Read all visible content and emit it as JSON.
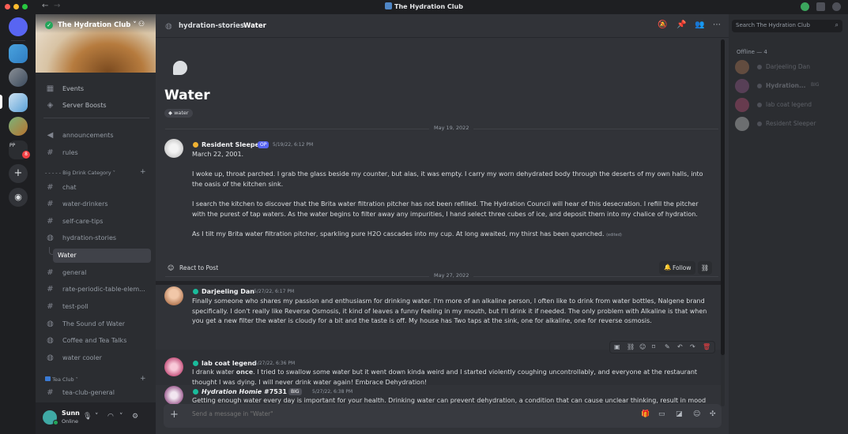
{
  "window": {
    "title": "The Hydration Club"
  },
  "server": {
    "name": "The Hydration Club"
  },
  "sidebar": {
    "top_items": [
      {
        "label": "Events",
        "icon": "calendar-icon"
      },
      {
        "label": "Server Boosts",
        "icon": "boost-icon"
      }
    ],
    "channels_before": [
      {
        "label": "announcements",
        "icon": "megaphone-icon"
      },
      {
        "label": "rules",
        "icon": "hashtag-icon"
      }
    ],
    "category_big": "Big Drink Category",
    "channels_big": [
      {
        "label": "chat"
      },
      {
        "label": "water-drinkers"
      },
      {
        "label": "self-care-tips"
      },
      {
        "label": "hydration-stories"
      },
      {
        "label": "Water"
      },
      {
        "label": "general"
      },
      {
        "label": "rate-periodic-table-elem..."
      },
      {
        "label": "test-poll"
      },
      {
        "label": "The Sound of Water"
      },
      {
        "label": "Coffee and Tea Talks"
      },
      {
        "label": "water cooler"
      }
    ],
    "category_tea": "Tea Club",
    "channels_tea": [
      {
        "label": "tea-club-general"
      }
    ]
  },
  "user": {
    "name": "Sunn",
    "status": "Online"
  },
  "header": {
    "parent": "hydration-stories",
    "separator": "›",
    "title": "Water"
  },
  "search": {
    "placeholder": "Search The Hydration Club"
  },
  "post": {
    "title": "Water",
    "tag": "water",
    "date_divider": "May 19, 2022",
    "author": "Resident Sleeper",
    "op_badge": "OP",
    "timestamp": "5/19/22, 6:12 PM",
    "paragraphs": [
      "March 22, 2001.",
      "I woke up, throat parched. I grab the glass beside my counter, but alas, it was empty. I carry my worn dehydrated body through the deserts of my own halls, into the oasis of the kitchen sink.",
      "I search the kitchen to discover that the Brita water filtration pitcher has not been refilled. The Hydration Council will hear of this desecration. I refill the pitcher with the purest of tap waters. As the water begins to filter away any impurities, I hand select three cubes of ice, and deposit them into my chalice of hydration.",
      "As I tilt my Brita water filtration pitcher, sparkling pure H2O cascades into my cup. At long awaited, my thirst has been quenched."
    ],
    "edited": "(edited)",
    "react_label": "React to Post",
    "follow_label": "Follow"
  },
  "replies": {
    "date_divider": "May 27, 2022",
    "messages": [
      {
        "author": "Darjeeling Dan",
        "timestamp": "5/27/22, 6:17 PM",
        "text": "Finally someone who shares my passion and enthusiasm for drinking water. I'm more of an alkaline person, I often like to drink from water bottles, Nalgene brand specifically. I don't really like Reverse Osmosis, it kind of leaves a funny feeling in my mouth, but I'll drink it if needed. The only problem with Alkaline is that when you get a new filter the water is cloudy for a bit and the taste is off. My house has Two taps at the sink, one for alkaline, one for reverse osmosis."
      },
      {
        "author": "lab coat legend",
        "timestamp": "5/27/22, 6:36 PM",
        "text_pre": "I drank water ",
        "text_bold": "once",
        "text_post": ". I tried to swallow some water but it went down kinda weird and I started violently coughing uncontrollably, and everyone at the restaurant thought I was dying. I will never drink water again! Embrace Dehydration!"
      },
      {
        "author": "𝙃𝙮𝙙𝙧𝙖𝙩𝙞𝙤𝙣 𝙃𝙤𝙢𝙞𝙚 #7531",
        "badge": "BIG",
        "timestamp": "5/27/22, 6:38 PM",
        "text": "Getting enough water every day is important for your health. Drinking water can prevent dehydration, a condition that can cause unclear thinking, result in mood change, cause your body to overheat, and lead to constipation and kidney stones. Most of your fluid needs are met through the water and beverages you drink. You can"
      }
    ]
  },
  "composer": {
    "placeholder": "Send a message in \"Water\""
  },
  "members": {
    "header": "Offline — 4",
    "list": [
      {
        "name": "Darjeeling Dan"
      },
      {
        "name": "Hydration...",
        "badge": "BIG"
      },
      {
        "name": "lab coat legend"
      },
      {
        "name": "Resident Sleeper"
      }
    ]
  },
  "rail": {
    "badge_count": "8"
  },
  "colors": {
    "accent": "#5865f2",
    "online": "#23a55a",
    "bg_main": "#313338",
    "bg_sidebar": "#2b2d31"
  }
}
